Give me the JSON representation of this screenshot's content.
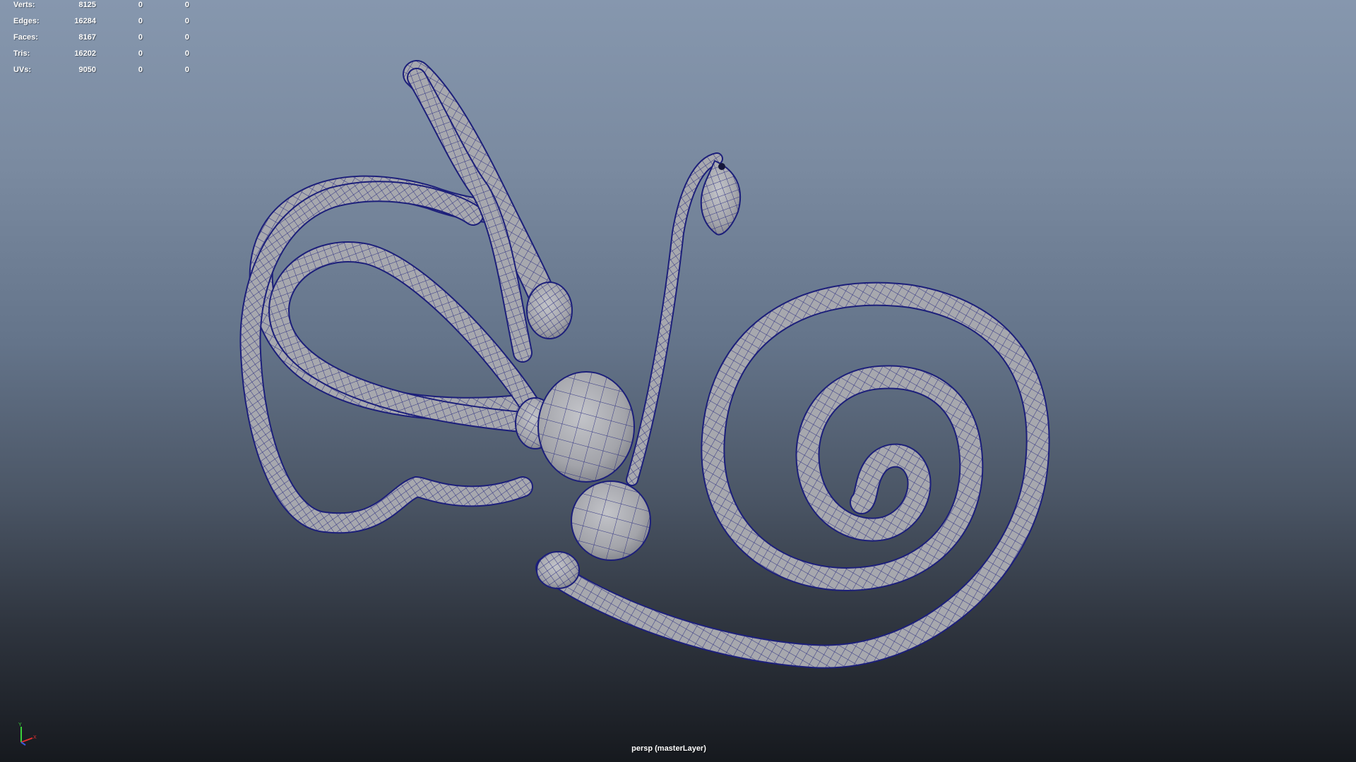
{
  "stats": [
    {
      "label": "Verts:",
      "total": "8125",
      "selected": "0",
      "component": "0"
    },
    {
      "label": "Edges:",
      "total": "16284",
      "selected": "0",
      "component": "0"
    },
    {
      "label": "Faces:",
      "total": "8167",
      "selected": "0",
      "component": "0"
    },
    {
      "label": "Tris:",
      "total": "16202",
      "selected": "0",
      "component": "0"
    },
    {
      "label": "UVs:",
      "total": "9050",
      "selected": "0",
      "component": "0"
    }
  ],
  "viewport": {
    "camera_label": "persp (masterLayer)"
  },
  "axis": {
    "y_label": "Y",
    "x_label": "X"
  },
  "colors": {
    "mesh_fill": "#a7a8ae",
    "wireframe": "#1c1f7a",
    "bg_top": "#8697ae",
    "bg_bottom": "#16191e"
  },
  "icons": {
    "axis_gizmo": "axis-gizmo-icon"
  }
}
